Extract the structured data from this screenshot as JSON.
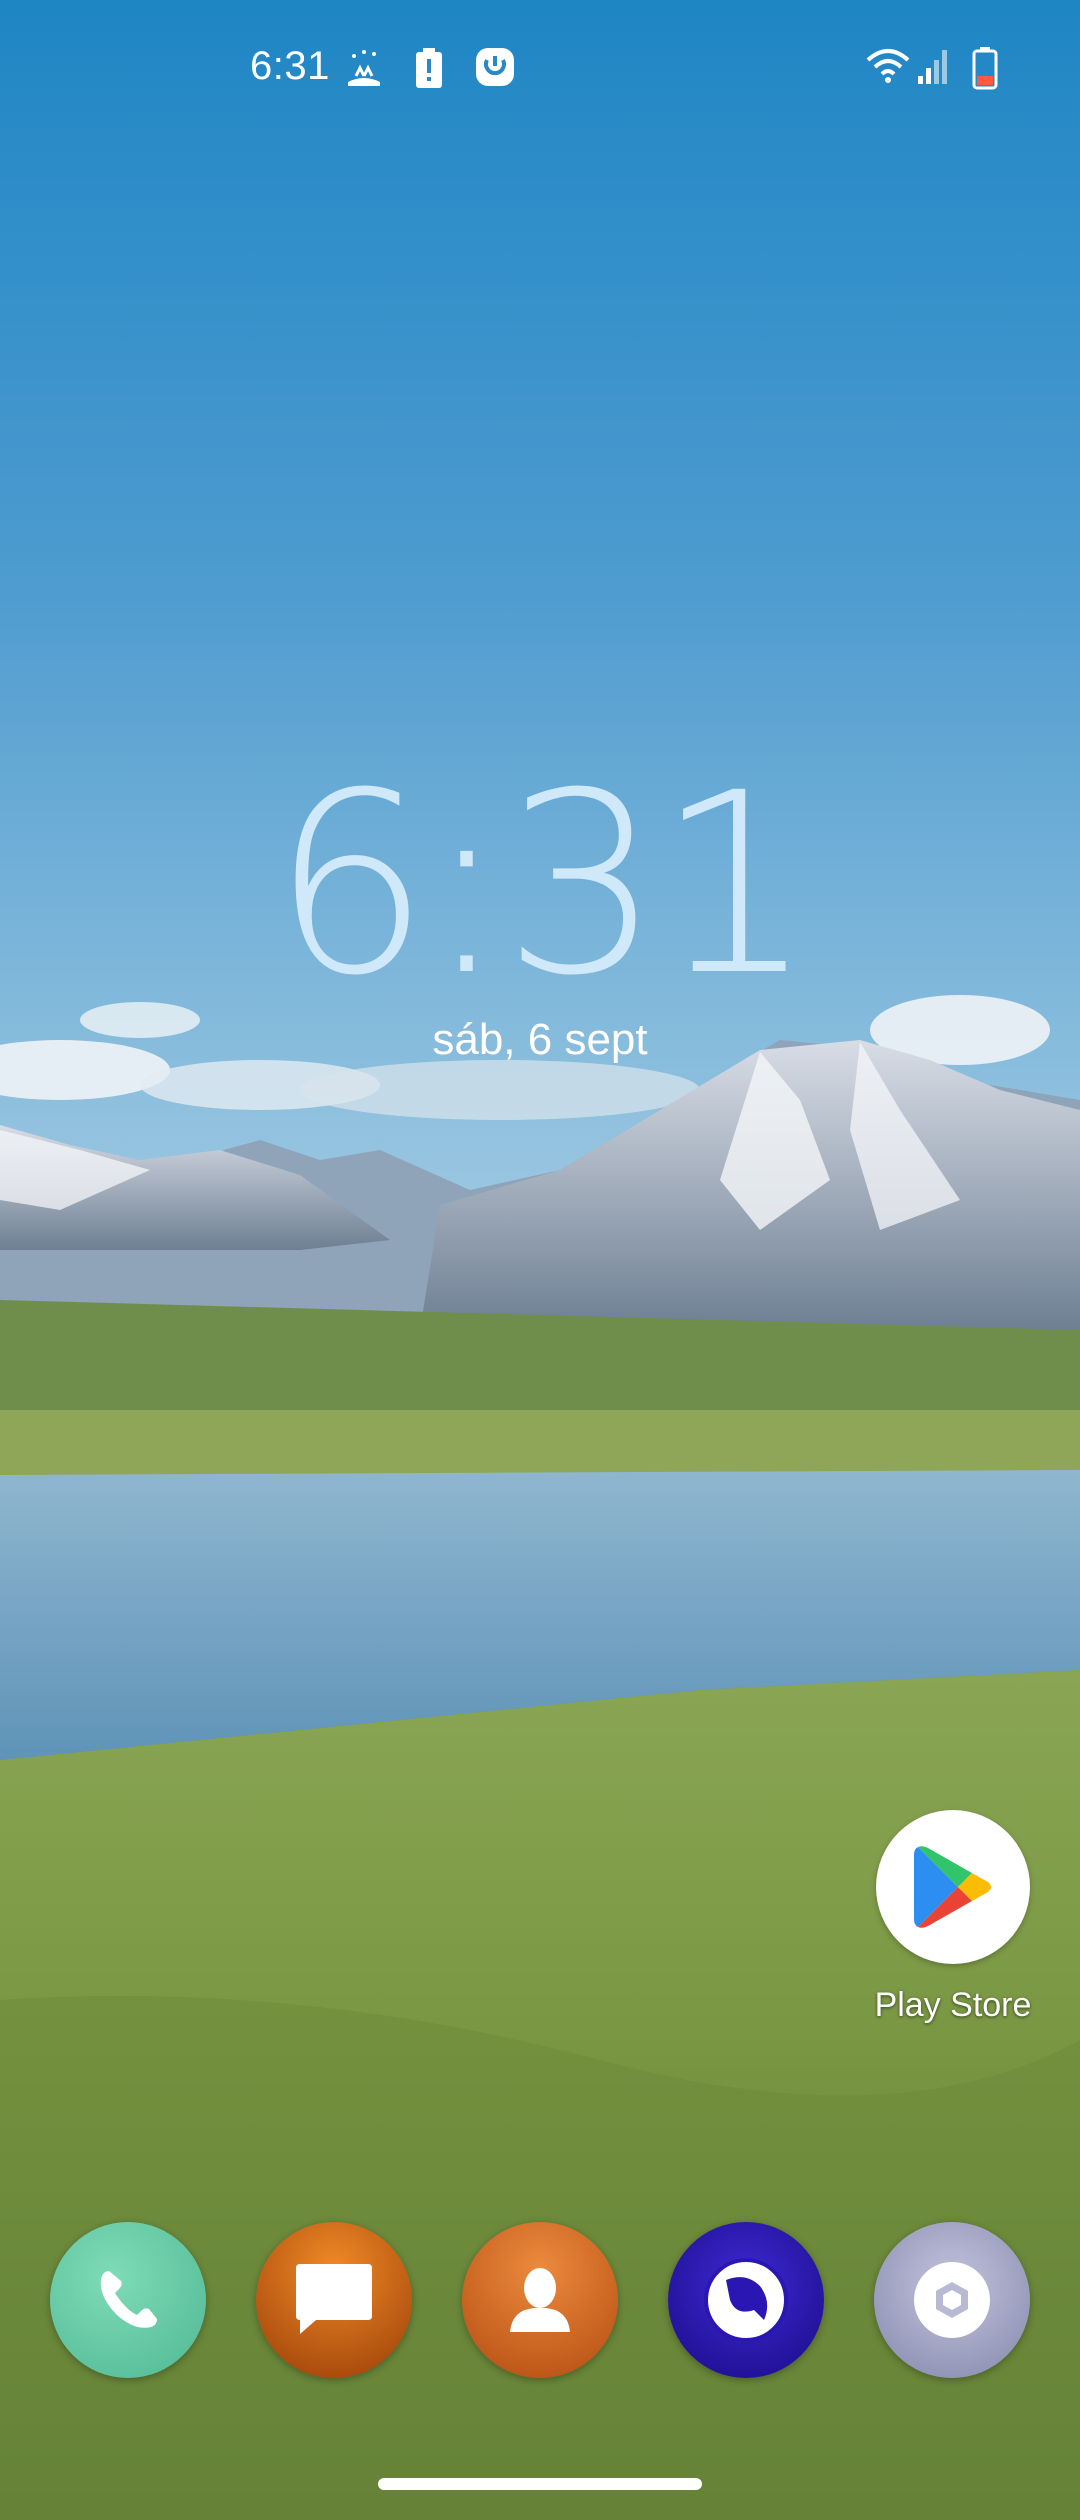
{
  "status_bar": {
    "time": "6:31",
    "left_icons": [
      "splash-notification-icon",
      "battery-alert-icon",
      "app-notification-icon"
    ],
    "right_icons": [
      "wifi-icon",
      "cell-signal-icon",
      "battery-low-icon"
    ]
  },
  "lockscreen": {
    "clock": "6:31",
    "date": "sáb, 6 sept"
  },
  "shortcuts": [
    {
      "label": "Play Store",
      "icon": "play-store-icon"
    }
  ],
  "dock": [
    {
      "icon": "phone-icon",
      "color": "#5cc7a2"
    },
    {
      "icon": "messages-icon",
      "color": "#e06a12"
    },
    {
      "icon": "contacts-icon",
      "color": "#d8661e"
    },
    {
      "icon": "browser-icon",
      "color": "#2f16b8"
    },
    {
      "icon": "camera-icon",
      "color": "#9ea0c2"
    }
  ]
}
